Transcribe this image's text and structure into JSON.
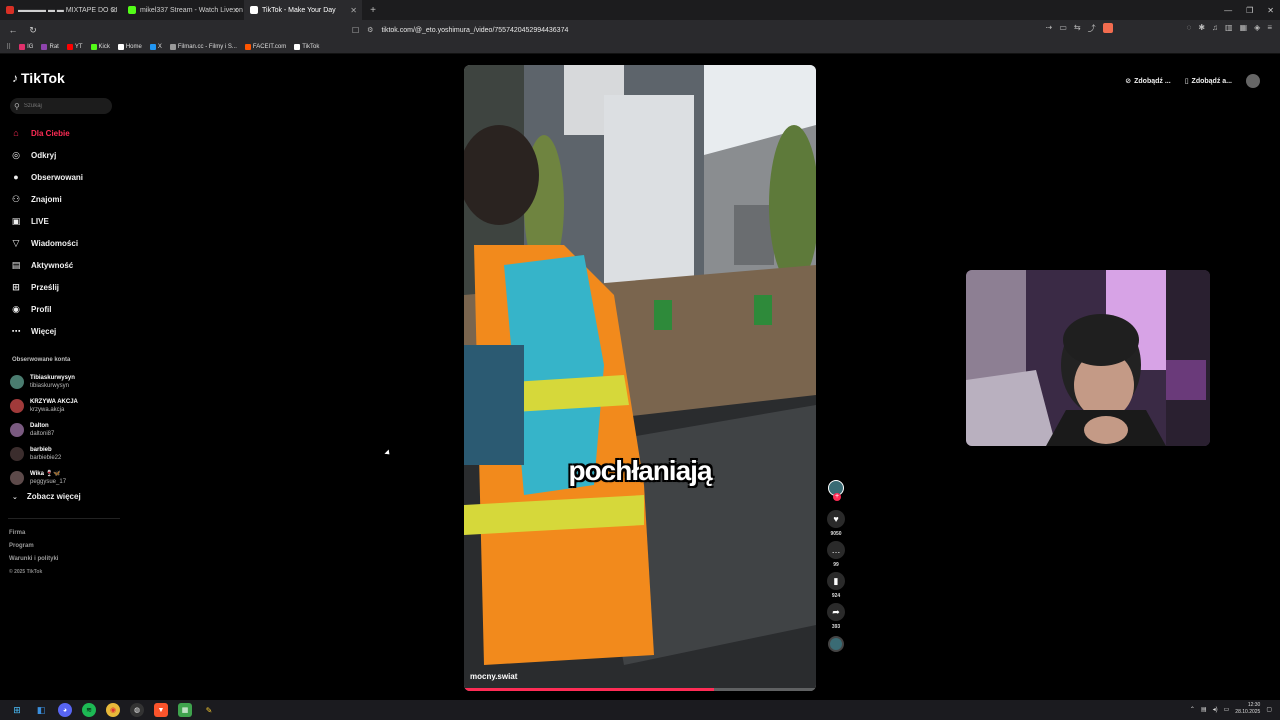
{
  "browser": {
    "tabs": [
      {
        "label": "▬▬▬▬ ▬ ▬ MIXTAPE DO CI",
        "color": "#d93025"
      },
      {
        "label": "mikel337 Stream - Watch Live on Ki",
        "color": "#53fc18"
      },
      {
        "label": "TikTok - Make Your Day",
        "color": "#ffffff",
        "active": true
      }
    ],
    "url": "tiktok.com/@_eto.yoshimura_/video/7557420452994436374",
    "bookmarks": [
      {
        "label": "IG",
        "color": "#e1306c"
      },
      {
        "label": "Rat",
        "color": "#8e44ad"
      },
      {
        "label": "YT",
        "color": "#ff0000"
      },
      {
        "label": "Kick",
        "color": "#53fc18"
      },
      {
        "label": "Home",
        "color": "#ffffff"
      },
      {
        "label": "X",
        "color": "#2196f3"
      },
      {
        "label": "Filman.cc - Filmy i S...",
        "color": "#999999"
      },
      {
        "label": "FACEIT.com",
        "color": "#ff5500"
      },
      {
        "label": "TikTok",
        "color": "#ffffff"
      }
    ]
  },
  "tiktok": {
    "logo": "TikTok",
    "search_placeholder": "Szukaj",
    "nav": [
      {
        "label": "Dla Ciebie",
        "icon": "home-icon",
        "glyph": "⌂",
        "active": true
      },
      {
        "label": "Odkryj",
        "icon": "compass-icon",
        "glyph": "◎"
      },
      {
        "label": "Obserwowani",
        "icon": "following-icon",
        "glyph": "●"
      },
      {
        "label": "Znajomi",
        "icon": "friends-icon",
        "glyph": "⚇"
      },
      {
        "label": "LIVE",
        "icon": "live-icon",
        "glyph": "▣"
      },
      {
        "label": "Wiadomości",
        "icon": "messages-icon",
        "glyph": "▽"
      },
      {
        "label": "Aktywność",
        "icon": "activity-icon",
        "glyph": "▤"
      },
      {
        "label": "Prześlij",
        "icon": "upload-icon",
        "glyph": "⊞"
      },
      {
        "label": "Profil",
        "icon": "profile-icon",
        "glyph": "◉"
      },
      {
        "label": "Więcej",
        "icon": "more-icon",
        "glyph": "⋯"
      }
    ],
    "followed_title": "Obserwowane konta",
    "followed": [
      {
        "name": "Tibiaskurwysyn",
        "handle": "tibiaskurwysyn",
        "color": "#4a7c6f"
      },
      {
        "name": "KRZYWA AKCJA",
        "handle": "krzywa.akcja",
        "color": "#a03a3a"
      },
      {
        "name": "Dalton",
        "handle": "daltoni87",
        "color": "#7a5a80"
      },
      {
        "name": "barbieb",
        "handle": "barbiebie22",
        "color": "#3b2d2d"
      },
      {
        "name": "Wika 🍷🦋",
        "handle": "peggysue_17",
        "color": "#5d4a4a"
      }
    ],
    "see_more": "Zobacz więcej",
    "footer": [
      "Firma",
      "Program",
      "Warunki i polityki"
    ],
    "copyright": "© 2025 TikTok",
    "top_right": [
      "Zdobądź ...",
      "Zdobądź a..."
    ]
  },
  "video": {
    "caption": "pochłaniają",
    "author": "mocny.swiat",
    "progress": 0.71,
    "likes": "9050",
    "comments": "99",
    "saves": "924",
    "shares": "393"
  },
  "taskbar": {
    "time": "12:30",
    "date": "28.10.2025"
  }
}
